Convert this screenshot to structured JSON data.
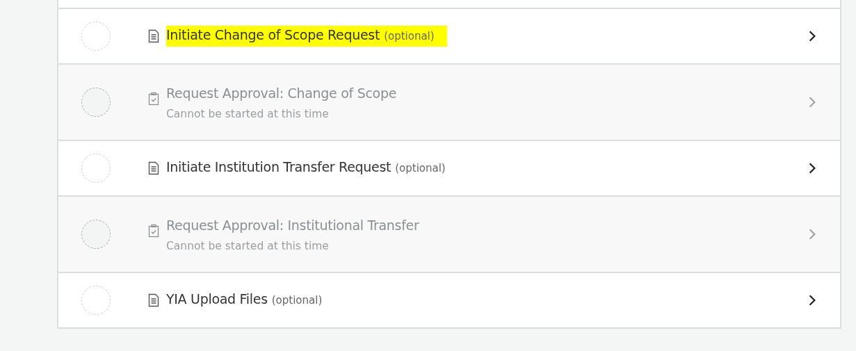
{
  "tasks": [
    {
      "kind": "form",
      "title": "Initiate Change of Scope Request",
      "note": "(optional)",
      "highlighted": true,
      "disabled": false
    },
    {
      "kind": "approval",
      "title": "Request Approval: Change of Scope",
      "subtitle": "Cannot be started at this time",
      "highlighted": false,
      "disabled": true
    },
    {
      "kind": "form",
      "title": "Initiate Institution Transfer Request",
      "note": "(optional)",
      "highlighted": false,
      "disabled": false
    },
    {
      "kind": "approval",
      "title": "Request Approval: Institutional Transfer",
      "subtitle": "Cannot be started at this time",
      "highlighted": false,
      "disabled": true
    },
    {
      "kind": "form",
      "title": "YIA Upload Files",
      "note": "(optional)",
      "highlighted": false,
      "disabled": false
    }
  ]
}
